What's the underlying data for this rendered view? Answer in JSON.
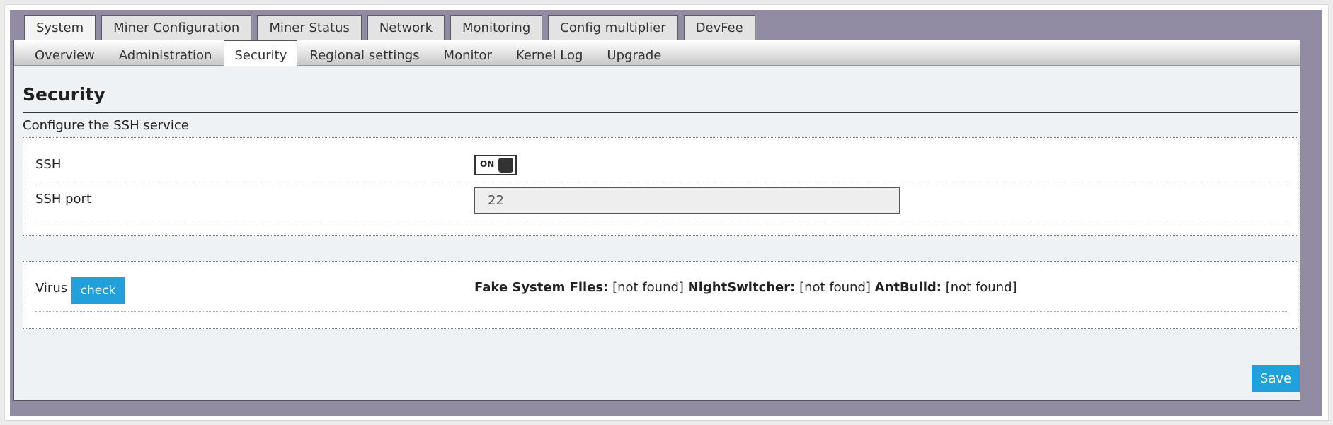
{
  "main_tabs": [
    {
      "label": "System"
    },
    {
      "label": "Miner Configuration"
    },
    {
      "label": "Miner Status"
    },
    {
      "label": "Network"
    },
    {
      "label": "Monitoring"
    },
    {
      "label": "Config multiplier"
    },
    {
      "label": "DevFee"
    }
  ],
  "sub_tabs": [
    {
      "label": "Overview"
    },
    {
      "label": "Administration"
    },
    {
      "label": "Security"
    },
    {
      "label": "Regional settings"
    },
    {
      "label": "Monitor"
    },
    {
      "label": "Kernel Log"
    },
    {
      "label": "Upgrade"
    }
  ],
  "page": {
    "title": "Security",
    "description": "Configure the SSH service"
  },
  "ssh": {
    "label": "SSH",
    "toggle_label": "ON",
    "port_label": "SSH port",
    "port_value": "22"
  },
  "virus": {
    "label": "Virus",
    "check_button": "check",
    "results": [
      {
        "name": "Fake System Files:",
        "status": "[not found]"
      },
      {
        "name": "NightSwitcher:",
        "status": "[not found]"
      },
      {
        "name": "AntBuild:",
        "status": "[not found]"
      }
    ]
  },
  "actions": {
    "save_label": "Save"
  },
  "colors": {
    "accent": "#21a1dc",
    "frame": "#918ca4",
    "panel": "#eff2f5"
  }
}
